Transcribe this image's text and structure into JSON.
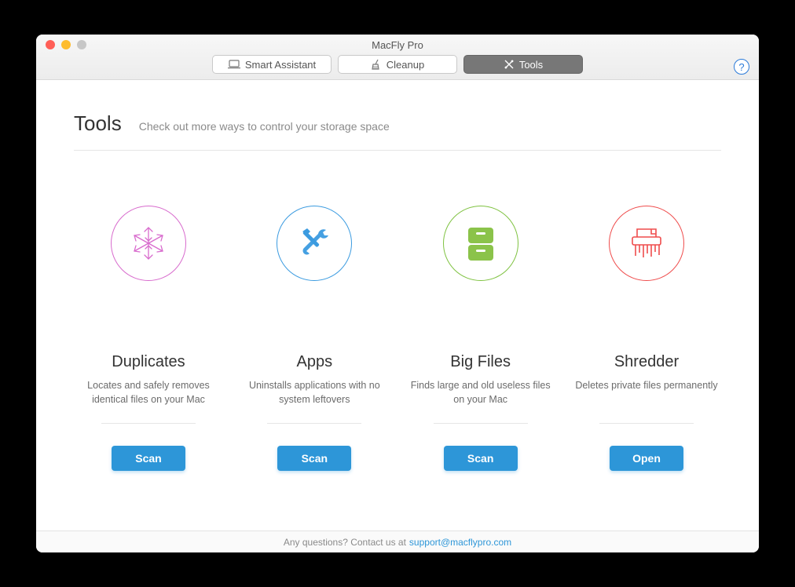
{
  "window": {
    "title": "MacFly Pro"
  },
  "tabs": {
    "smart_assistant": "Smart Assistant",
    "cleanup": "Cleanup",
    "tools": "Tools",
    "active": "tools"
  },
  "help": "?",
  "page": {
    "title": "Tools",
    "subtitle": "Check out more ways to control your storage space"
  },
  "cards": [
    {
      "icon": "snowflake-icon",
      "circle_color": "pink",
      "title": "Duplicates",
      "description": "Locates and safely removes identical files on your Mac",
      "button": "Scan"
    },
    {
      "icon": "wrench-icon",
      "circle_color": "blue",
      "title": "Apps",
      "description": "Uninstalls applications with no system leftovers",
      "button": "Scan"
    },
    {
      "icon": "drawer-icon",
      "circle_color": "green",
      "title": "Big Files",
      "description": "Finds large and old useless files on your Mac",
      "button": "Scan"
    },
    {
      "icon": "shredder-icon",
      "circle_color": "red",
      "title": "Shredder",
      "description": "Deletes private files permanently",
      "button": "Open"
    }
  ],
  "footer": {
    "text": "Any questions? Contact us at ",
    "link": "support@macflypro.com"
  }
}
